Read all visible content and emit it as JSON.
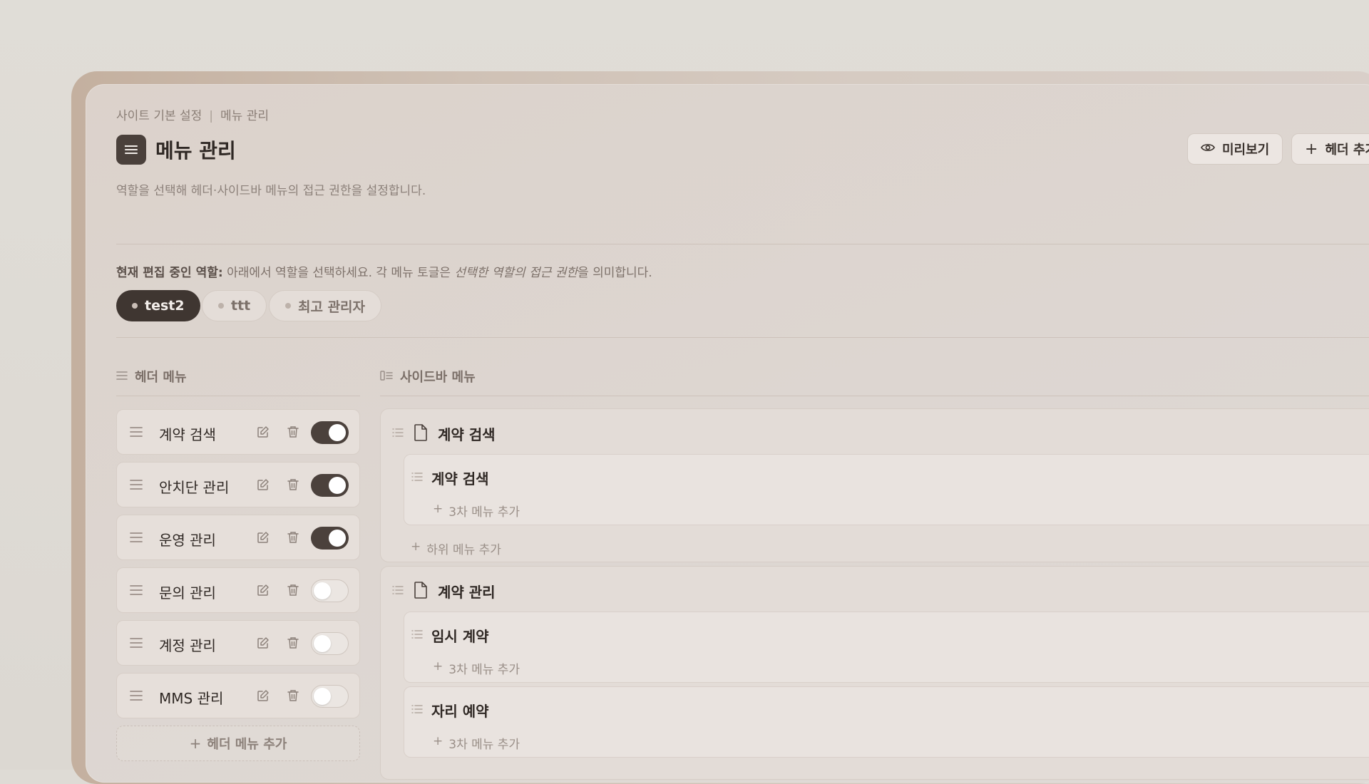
{
  "breadcrumb": {
    "parent": "사이트 기본 설정",
    "separator": "|",
    "current": "메뉴 관리"
  },
  "page": {
    "title": "메뉴 관리",
    "description": "역할을 선택해 헤더·사이드바 메뉴의 접근 권한을 설정합니다."
  },
  "toolbar": {
    "preview_label": "미리보기",
    "add_header_label": "헤더 추가"
  },
  "role_note": {
    "prefix": "현재 편집 중인 역할:",
    "text1": " 아래에서 역할을 선택하세요. 각 메뉴 토글은 ",
    "emphasis": "선택한 역할의 접근 권한",
    "text2": "을 의미합니다."
  },
  "roles": [
    {
      "label": "test2",
      "active": true
    },
    {
      "label": "ttt",
      "active": false
    },
    {
      "label": "최고 관리자",
      "active": false
    }
  ],
  "header_menu": {
    "section_label": "헤더 메뉴",
    "items": [
      {
        "label": "계약 검색",
        "enabled": true
      },
      {
        "label": "안치단 관리",
        "enabled": true
      },
      {
        "label": "운영 관리",
        "enabled": true
      },
      {
        "label": "문의 관리",
        "enabled": false
      },
      {
        "label": "계정 관리",
        "enabled": false
      },
      {
        "label": "MMS 관리",
        "enabled": false
      }
    ],
    "add_label": "헤더 메뉴 추가"
  },
  "sidebar_menu": {
    "section_label": "사이드바 메뉴",
    "groups": [
      {
        "title": "계약 검색",
        "children": [
          {
            "title": "계약 검색",
            "add_label": "3차 메뉴 추가"
          }
        ],
        "add_label": "하위 메뉴 추가"
      },
      {
        "title": "계약 관리",
        "children": [
          {
            "title": "임시 계약",
            "add_label": "3차 메뉴 추가"
          },
          {
            "title": "자리 예약",
            "add_label": "3차 메뉴 추가"
          }
        ]
      }
    ]
  },
  "colors": {
    "accent_dark": "#3f3631",
    "toggle_on": "#4b413c",
    "panel_bg": "#ddd6d1"
  },
  "icons": {
    "title": "menu-list-icon",
    "preview": "eye-icon",
    "add": "plus-icon",
    "drag": "drag-handle-icon",
    "edit": "edit-icon",
    "delete": "trash-icon",
    "page": "file-icon"
  }
}
